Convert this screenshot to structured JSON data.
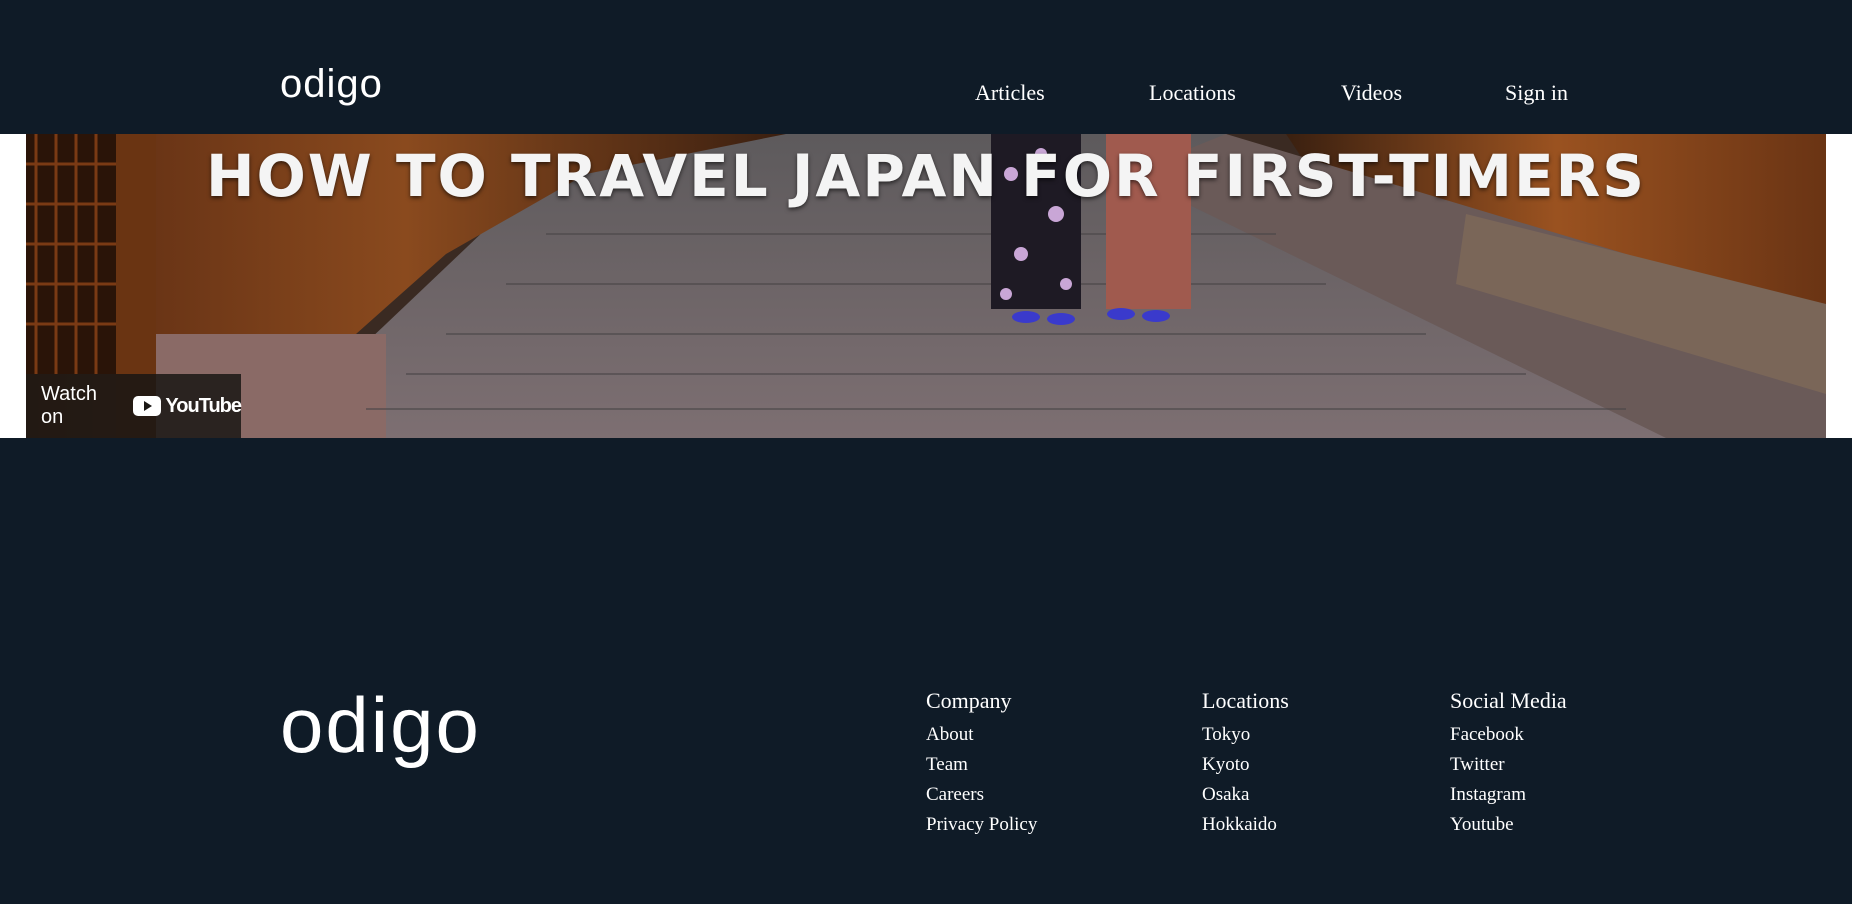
{
  "header": {
    "logo": "odigo",
    "nav": [
      "Articles",
      "Locations",
      "Videos",
      "Sign in"
    ]
  },
  "video": {
    "title": "HOW TO TRAVEL JAPAN FOR FIRST-TIMERS",
    "watch_on": "Watch on",
    "youtube_label": "YouTube"
  },
  "footer": {
    "logo": "odigo",
    "columns": [
      {
        "title": "Company",
        "links": [
          "About",
          "Team",
          "Careers",
          "Privacy Policy"
        ]
      },
      {
        "title": "Locations",
        "links": [
          "Tokyo",
          "Kyoto",
          "Osaka",
          "Hokkaido"
        ]
      },
      {
        "title": "Social Media",
        "links": [
          "Facebook",
          "Twitter",
          "Instagram",
          "Youtube"
        ]
      }
    ]
  },
  "colors": {
    "background": "#0f1b27",
    "text": "#ffffff",
    "youtube_red": "#ffffff"
  }
}
